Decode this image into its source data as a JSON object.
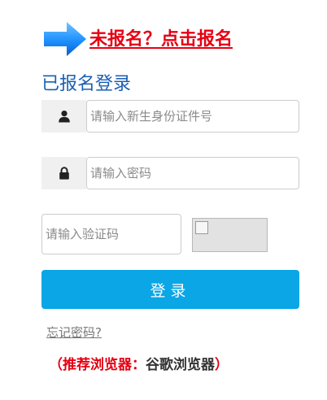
{
  "register_link": "未报名？点击报名",
  "section_title": "已报名登录",
  "id_field": {
    "placeholder": "请输入新生身份证件号",
    "icon": "user-icon"
  },
  "password_field": {
    "placeholder": "请输入密码",
    "icon": "lock-icon"
  },
  "captcha_field": {
    "placeholder": "请输入验证码"
  },
  "captcha_image": {
    "icon": "broken-image-icon"
  },
  "login_button": "登录",
  "forgot_password": "忘记密码?",
  "browser_tip": {
    "prefix": "（推荐浏览器：",
    "browser": "谷歌浏览器",
    "suffix": "）"
  },
  "colors": {
    "accent": "#0aa6e6",
    "title": "#1a5fb4",
    "alert": "#e50012",
    "arrow": "#1e90ff"
  }
}
